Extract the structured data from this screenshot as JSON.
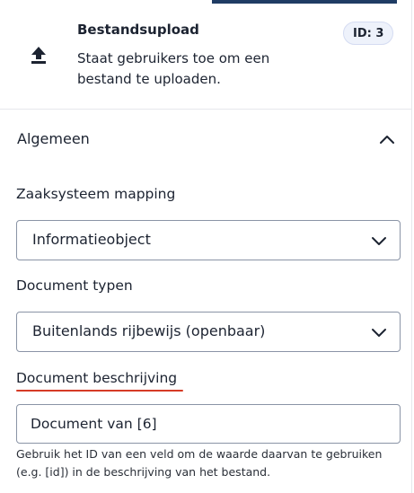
{
  "header": {
    "icon": "upload-icon",
    "title": "Bestandsupload",
    "description": "Staat gebruikers toe om een bestand te uploaden.",
    "id_badge": "ID: 3"
  },
  "section": {
    "title": "Algemeen",
    "collapse_icon": "chevron-up-icon"
  },
  "fields": {
    "zaaksysteem_mapping": {
      "label": "Zaaksysteem mapping",
      "selected": "Informatieobject"
    },
    "document_typen": {
      "label": "Document typen",
      "selected": "Buitenlands rijbewijs (openbaar)"
    },
    "document_beschrijving": {
      "label": "Document beschrijving",
      "value": "Document van [6]",
      "help": "Gebruik het ID van een veld om de waarde daarvan te gebruiken (e.g. [id]) in de beschrijving van het bestand."
    }
  },
  "colors": {
    "accent_bar": "#1f3c64",
    "highlight_underline": "#d63b26",
    "badge_bg": "#eef2fb"
  }
}
